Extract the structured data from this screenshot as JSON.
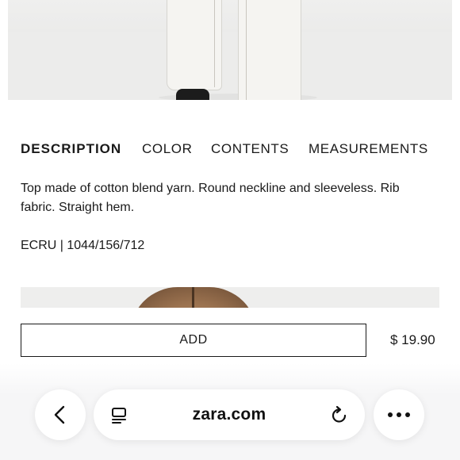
{
  "tabs": [
    {
      "label": "DESCRIPTION",
      "active": true
    },
    {
      "label": "COLOR",
      "active": false
    },
    {
      "label": "CONTENTS",
      "active": false
    },
    {
      "label": "MEASUREMENTS",
      "active": false
    }
  ],
  "product": {
    "description": "Top made of cotton blend yarn. Round neckline and sleeveless. Rib fabric. Straight hem.",
    "reference": "ECRU | 1044/156/712",
    "price": "$ 19.90"
  },
  "actions": {
    "add_label": "ADD"
  },
  "browser": {
    "url": "zara.com",
    "icons": [
      "chevron-left-icon",
      "reader-icon",
      "reload-icon",
      "more-icon"
    ]
  }
}
